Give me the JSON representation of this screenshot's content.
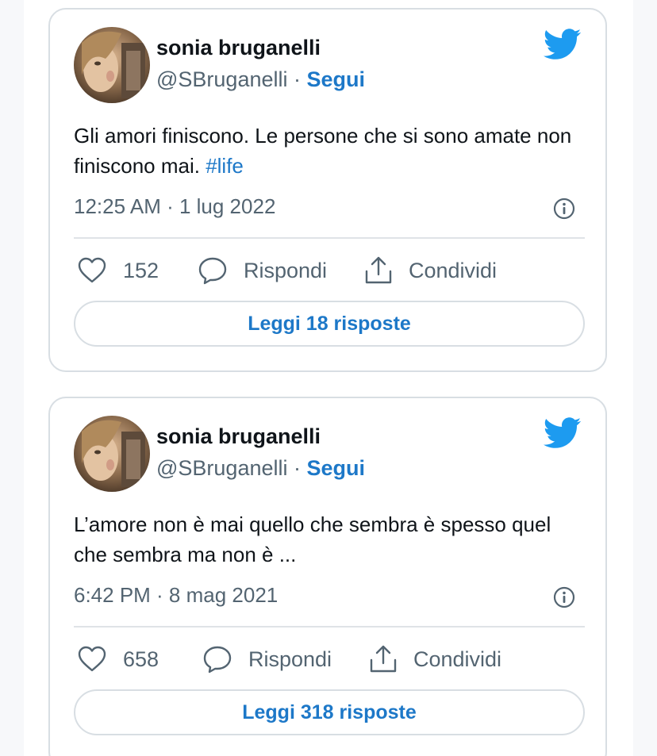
{
  "tweets": [
    {
      "author_name": "sonia bruganelli",
      "handle": "@SBruganelli",
      "separator": " · ",
      "follow_label": "Segui",
      "text": "Gli amori finiscono. Le persone che si sono amate non finiscono mai. ",
      "hashtag": "#life",
      "timestamp": "12:25 AM · 1 lug 2022",
      "likes": "152",
      "reply_label": "Rispondi",
      "share_label": "Condividi",
      "read_replies_label": "Leggi 18 risposte"
    },
    {
      "author_name": "sonia bruganelli",
      "handle": "@SBruganelli",
      "separator": " · ",
      "follow_label": "Segui",
      "text": "L’amore non è mai quello che sembra è spesso quel  che sembra ma non è ...",
      "hashtag": "",
      "timestamp": "6:42 PM · 8 mag 2021",
      "likes": "658",
      "reply_label": "Rispondi",
      "share_label": "Condividi",
      "read_replies_label": "Leggi 318 risposte"
    }
  ],
  "colors": {
    "accent": "#1d78c8",
    "twitter_blue": "#1d9bf0",
    "secondary_text": "#536471",
    "border": "#d8dee3"
  },
  "icons": {
    "logo": "twitter-bird-icon",
    "info": "info-icon",
    "like": "heart-icon",
    "reply": "speech-bubble-icon",
    "share": "share-icon"
  }
}
